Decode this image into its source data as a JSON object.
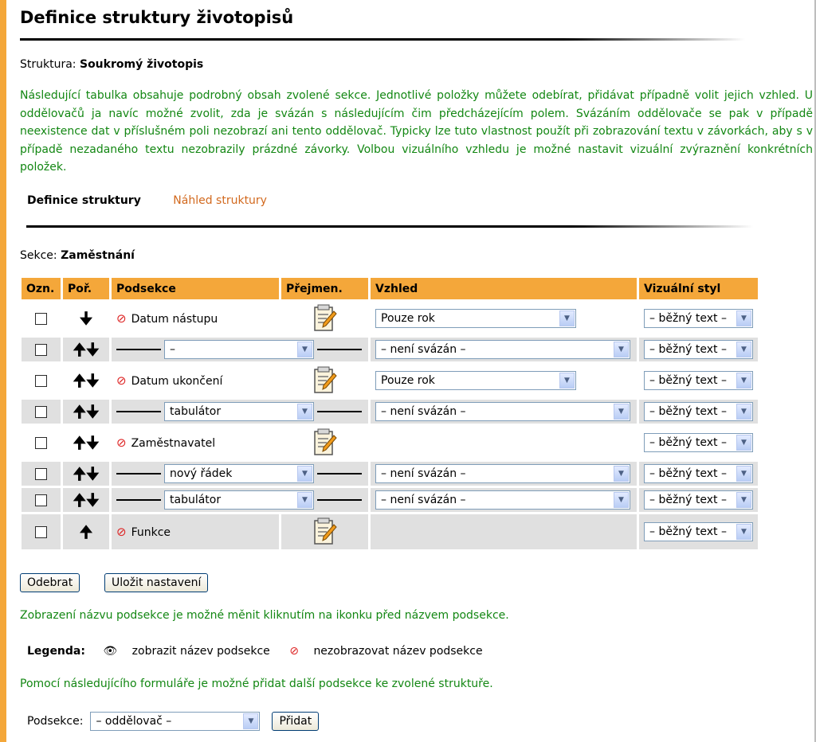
{
  "page": {
    "title": "Definice struktury životopisů",
    "structure_label": "Struktura:",
    "structure_value": "Soukromý životopis",
    "intro": "Následující tabulka obsahuje podrobný obsah zvolené sekce. Jednotlivé položky můžete odebírat, přidávat případně volit jejich vzhled. U oddělovačů ja navíc možné zvolit, zda je svázán s následujícím čim předcházejícím polem. Svázáním oddělovače se pak v případě neexistence dat v příslušném poli nezobrazí ani tento oddělovač. Typicky lze tuto vlastnost použít při zobrazování textu v závorkách, aby s v případě nezadaného textu nezobrazily prázdné závorky. Volbou vizuálního vzhledu je možné nastavit vizuální zvýraznění konkrétních položek."
  },
  "tabs": {
    "active": "Definice struktury",
    "other": "Náhled struktury"
  },
  "section": {
    "label": "Sekce:",
    "value": "Zaměstnání"
  },
  "table": {
    "headers": [
      "Ozn.",
      "Poř.",
      "Podsekce",
      "Přejmen.",
      "Vzhled",
      "Vizuální styl"
    ],
    "rows": [
      {
        "kind": "field",
        "arrows": "down",
        "label": "Datum nástupu",
        "vzhled": "Pouze rok",
        "style": "– běžný text –"
      },
      {
        "kind": "sep",
        "arrows": "both",
        "sep": "–",
        "vzhled": "– není svázán –",
        "style": "– běžný text –"
      },
      {
        "kind": "field",
        "arrows": "both",
        "label": "Datum ukončení",
        "vzhled": "Pouze rok",
        "style": "– běžný text –"
      },
      {
        "kind": "sep",
        "arrows": "both",
        "sep": "tabulátor",
        "vzhled": "– není svázán –",
        "style": "– běžný text –"
      },
      {
        "kind": "field",
        "arrows": "both",
        "label": "Zaměstnavatel",
        "vzhled": "",
        "style": "– běžný text –"
      },
      {
        "kind": "sep",
        "arrows": "both",
        "sep": "nový řádek",
        "vzhled": "– není svázán –",
        "style": "– běžný text –"
      },
      {
        "kind": "sep",
        "arrows": "both",
        "sep": "tabulátor",
        "vzhled": "– není svázán –",
        "style": "– běžný text –"
      },
      {
        "kind": "field",
        "arrows": "up",
        "label": "Funkce",
        "vzhled": "",
        "style": "– běžný text –"
      }
    ]
  },
  "buttons": {
    "remove": "Odebrat",
    "save": "Uložit nastavení",
    "add": "Přidat"
  },
  "hint": "Zobrazení názvu podsekce je možné měnit kliknutím na ikonku před názvem podsekce.",
  "legend": {
    "label": "Legenda:",
    "show": "zobrazit název podsekce",
    "hide": "nezobrazovat název podsekce"
  },
  "add_form": {
    "hint": "Pomocí následujícího formuláře je možné přidat další podsekce ke zvolené struktuře.",
    "label": "Podsekce:",
    "value": "– oddělovač –"
  },
  "icons": {
    "hide_icon": "⊘",
    "eye_icon": "👁",
    "up_arrow": "🠉",
    "down_arrow": "🠋"
  },
  "colors": {
    "accent": "#f4a73a",
    "text_green": "#138713",
    "link_orange": "#d2691e",
    "row_shade": "#e0e0e0"
  }
}
